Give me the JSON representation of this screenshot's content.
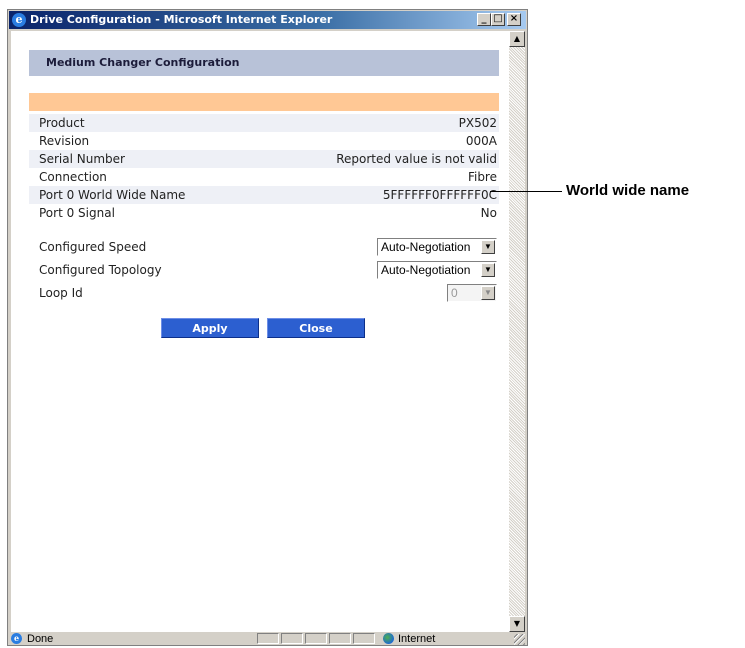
{
  "window": {
    "title": "Drive Configuration - Microsoft Internet Explorer",
    "controls": {
      "minimize": "_",
      "maximize": "□",
      "close": "×"
    }
  },
  "page": {
    "header": "Medium Changer Configuration",
    "info_rows": [
      {
        "label": "Product",
        "value": "PX502"
      },
      {
        "label": "Revision",
        "value": "000A"
      },
      {
        "label": "Serial Number",
        "value": "Reported value is not valid"
      },
      {
        "label": "Connection",
        "value": "Fibre"
      },
      {
        "label": "Port 0 World Wide Name",
        "value": "5FFFFFF0FFFFFF0C"
      },
      {
        "label": "Port 0 Signal",
        "value": "No"
      }
    ],
    "config": {
      "speed_label": "Configured Speed",
      "speed_value": "Auto-Negotiation",
      "topology_label": "Configured Topology",
      "topology_value": "Auto-Negotiation",
      "loop_label": "Loop Id",
      "loop_value": "0"
    },
    "buttons": {
      "apply": "Apply",
      "close": "Close"
    }
  },
  "statusbar": {
    "status": "Done",
    "zone": "Internet"
  },
  "callout": {
    "label": "World wide name"
  },
  "icons": {
    "title_icon": "ie-icon",
    "status_icon": "ie-page-icon",
    "zone_icon": "globe-icon",
    "dropdown_icon": "chevron-down-icon"
  },
  "colors": {
    "title_start": "#0a246a",
    "header_bar": "#b8c2d8",
    "peach_bar": "#ffc895",
    "button": "#2c5fd0"
  }
}
